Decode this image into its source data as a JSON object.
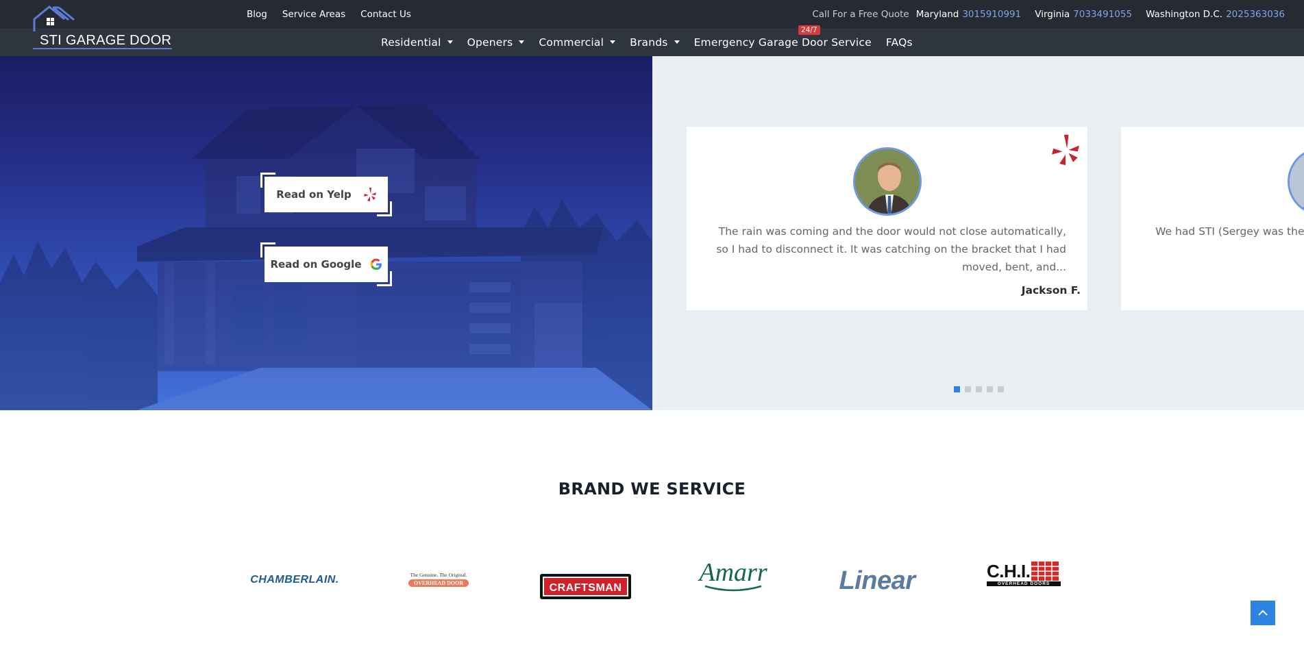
{
  "header": {
    "logo_text": "STI GARAGE DOOR",
    "top_links": [
      "Blog",
      "Service Areas",
      "Contact Us"
    ],
    "contact_lead": "Call For a Free Quote",
    "regions": [
      {
        "name": "Maryland",
        "phone": "3015910991"
      },
      {
        "name": "Virginia",
        "phone": "7033491055"
      },
      {
        "name": "Washington D.C.",
        "phone": "2025363036"
      }
    ],
    "nav": [
      {
        "label": "Residential",
        "dropdown": true
      },
      {
        "label": "Openers",
        "dropdown": true
      },
      {
        "label": "Commercial",
        "dropdown": true
      },
      {
        "label": "Brands",
        "dropdown": true
      },
      {
        "label": "Emergency Garage Door Service",
        "dropdown": false
      },
      {
        "label": "FAQs",
        "dropdown": false
      }
    ],
    "badge": "24/7"
  },
  "hero": {
    "read_yelp": "Read on Yelp",
    "read_google": "Read on Google"
  },
  "reviews": {
    "cards": [
      {
        "text": "The rain was coming and the door would not close automatically, so I had to disconnect it. It was catching on the bracket that I had moved, bent, and...",
        "author": "Jackson F."
      },
      {
        "text": "We had STI (Sergey was there of door openers (complete syste",
        "author": ""
      }
    ],
    "dots_total": 5,
    "active_dot": 1
  },
  "brands": {
    "title": "BRAND WE SERVICE",
    "logos": [
      "CHAMBERLAIN.",
      "The Genuine. The Original.",
      "OVERHEAD DOOR",
      "CRAFTSMAN",
      "Amarr",
      "Linear",
      "C.H.I.",
      "OVERHEAD DOORS"
    ]
  },
  "colors": {
    "topbar": "#262b33",
    "navbar": "#2f353e",
    "phone": "#7fa2ee",
    "accent": "#2a84e0",
    "badge": "#d63a3a",
    "yelp_red": "#c4252f"
  }
}
